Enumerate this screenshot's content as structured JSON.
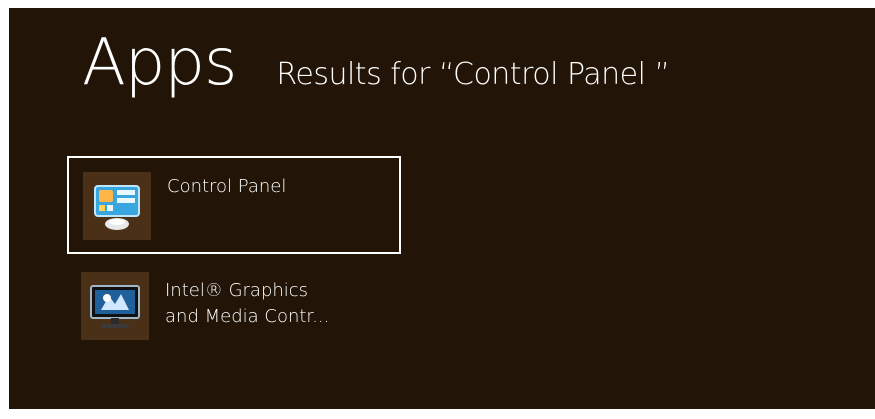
{
  "header": {
    "title": "Apps",
    "subtitle": "Results for “Control Panel ”"
  },
  "results": [
    {
      "label_lines": [
        "Control Panel"
      ],
      "icon": "control-panel-icon",
      "selected": true
    },
    {
      "label_lines": [
        "Intel® Graphics",
        "and Media Contr..."
      ],
      "icon": "intel-graphics-icon",
      "selected": false
    }
  ],
  "colors": {
    "background": "#221508",
    "tile_icon_bg": "#4a3017",
    "selection_border": "#ffffff",
    "text": "#ffffff"
  }
}
